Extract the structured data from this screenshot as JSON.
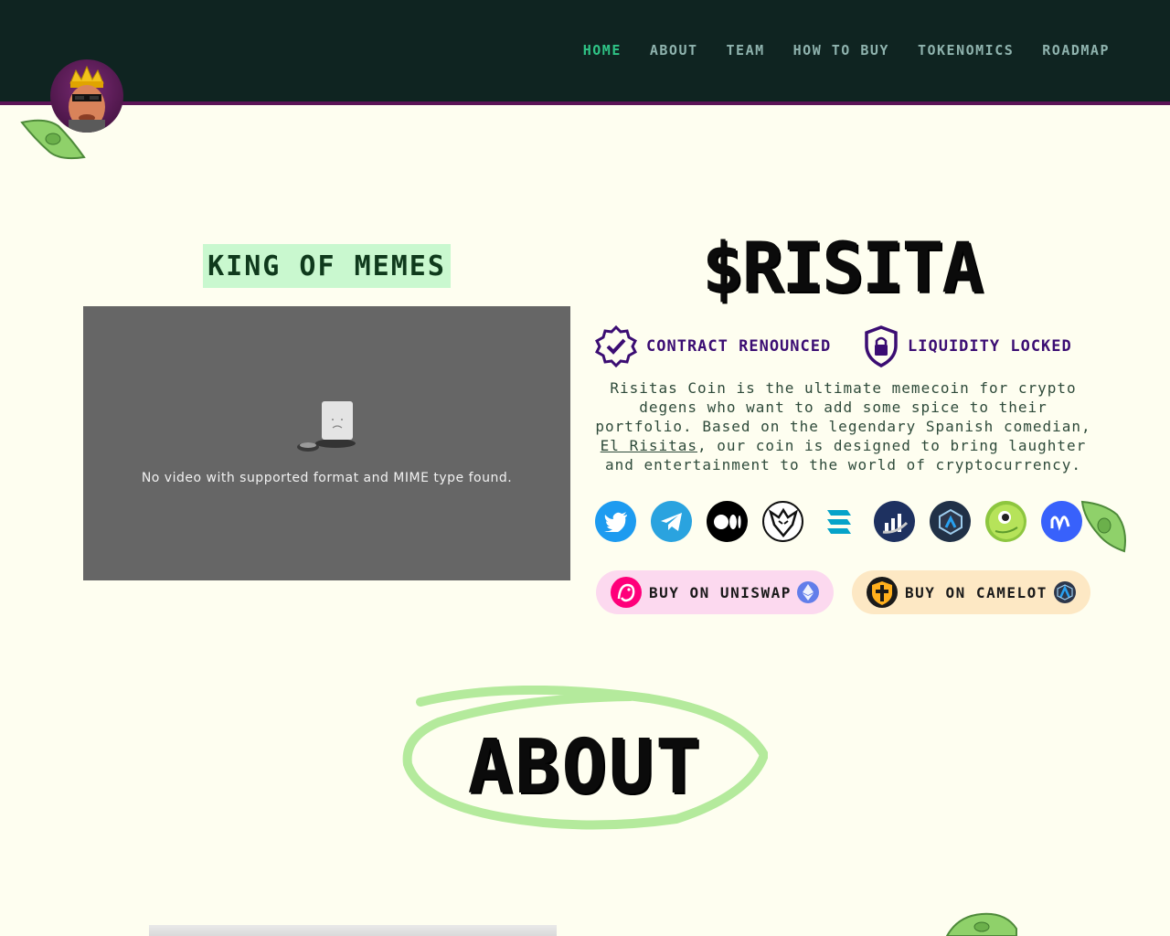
{
  "nav": {
    "items": [
      {
        "label": "HOME",
        "active": true
      },
      {
        "label": "ABOUT",
        "active": false
      },
      {
        "label": "TEAM",
        "active": false
      },
      {
        "label": "HOW TO BUY",
        "active": false
      },
      {
        "label": "TOKENOMICS",
        "active": false
      },
      {
        "label": "ROADMAP",
        "active": false
      }
    ]
  },
  "hero": {
    "tagline": "KING OF MEMES",
    "video_message": "No video with supported format and MIME type found.",
    "ticker": "$RISITA",
    "badges": [
      {
        "icon": "verified-check-icon",
        "label": "CONTRACT RENOUNCED"
      },
      {
        "icon": "shield-lock-icon",
        "label": "LIQUIDITY LOCKED"
      }
    ],
    "description_before": "Risitas Coin is the ultimate memecoin for crypto degens who want to add some spice to their portfolio. Based on the legendary Spanish comedian, ",
    "description_link": "El Risitas",
    "description_after": ", our coin is designed to bring laughter and entertainment to the world of cryptocurrency.",
    "socials": [
      {
        "icon": "twitter-icon",
        "color": "#1d9bf0"
      },
      {
        "icon": "telegram-icon",
        "color": "#2aa3df"
      },
      {
        "icon": "medium-icon",
        "color": "#000000"
      },
      {
        "icon": "eagle-icon",
        "color": "#ffffff"
      },
      {
        "icon": "dextools-icon",
        "color": "#05a3c9"
      },
      {
        "icon": "dexscreener-icon",
        "color": "#1e3160"
      },
      {
        "icon": "arbiscan-icon",
        "color": "#213147"
      },
      {
        "icon": "coingecko-icon",
        "color": "#8dc63f"
      },
      {
        "icon": "coinmarketcap-icon",
        "color": "#3861fb"
      }
    ],
    "buy_buttons": [
      {
        "label": "BUY ON UNISWAP",
        "icon": "uniswap-icon",
        "chain_icon": "ethereum-icon",
        "bg": "#fcd9ef"
      },
      {
        "label": "BUY ON CAMELOT",
        "icon": "camelot-icon",
        "chain_icon": "arbitrum-icon",
        "bg": "#fde8c4"
      }
    ]
  },
  "about": {
    "title": "ABOUT"
  },
  "colors": {
    "header_bg": "#0f2421",
    "header_accent": "#5c1457",
    "nav_active": "#2fc486",
    "page_bg": "#fefef0",
    "highlight": "#c9f8cf"
  }
}
